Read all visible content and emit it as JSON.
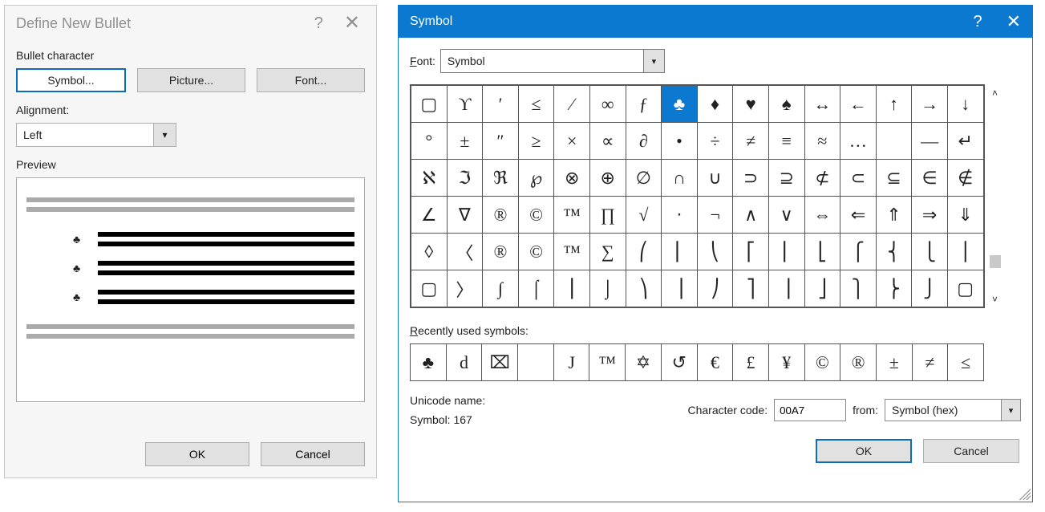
{
  "define": {
    "title": "Define New Bullet",
    "help": "?",
    "close": "✕",
    "bullet_char_label": "Bullet character",
    "symbol_btn": "Symbol...",
    "picture_btn": "Picture...",
    "font_btn": "Font...",
    "alignment_label": "Alignment:",
    "alignment_value": "Left",
    "preview_label": "Preview",
    "preview_bullet": "♣",
    "ok": "OK",
    "cancel": "Cancel"
  },
  "symbol": {
    "title": "Symbol",
    "help": "?",
    "close": "✕",
    "font_label": "Font:",
    "font_value": "Symbol",
    "grid": [
      [
        "▢",
        "ϒ",
        "′",
        "≤",
        "⁄",
        "∞",
        "ƒ",
        "♣",
        "♦",
        "♥",
        "♠",
        "↔",
        "←",
        "↑",
        "→",
        "↓"
      ],
      [
        "°",
        "±",
        "″",
        "≥",
        "×",
        "∝",
        "∂",
        "•",
        "÷",
        "≠",
        "≡",
        "≈",
        "…",
        "",
        "—",
        "↵"
      ],
      [
        "ℵ",
        "ℑ",
        "ℜ",
        "℘",
        "⊗",
        "⊕",
        "∅",
        "∩",
        "∪",
        "⊃",
        "⊇",
        "⊄",
        "⊂",
        "⊆",
        "∈",
        "∉"
      ],
      [
        "∠",
        "∇",
        "®",
        "©",
        "™",
        "∏",
        "√",
        "⋅",
        "¬",
        "∧",
        "∨",
        "⇔",
        "⇐",
        "⇑",
        "⇒",
        "⇓"
      ],
      [
        "◊",
        "〈",
        "®",
        "©",
        "™",
        "∑",
        "⎛",
        "⎜",
        "⎝",
        "⎡",
        "⎢",
        "⎣",
        "⎧",
        "⎨",
        "⎩",
        "⎪"
      ],
      [
        "▢",
        "〉",
        "∫",
        "⌠",
        "⎮",
        "⌡",
        "⎞",
        "⎟",
        "⎠",
        "⎤",
        "⎥",
        "⎦",
        "⎫",
        "⎬",
        "⎭",
        "▢"
      ]
    ],
    "selected_row": 0,
    "selected_col": 7,
    "recent_label": "Recently used symbols:",
    "recent": [
      "♣",
      "d",
      "⌧",
      "",
      "J",
      "™",
      "✡",
      "↺",
      "€",
      "£",
      "¥",
      "©",
      "®",
      "±",
      "≠",
      "≤"
    ],
    "unicode_name_label": "Unicode name:",
    "unicode_name_value": "Symbol: 167",
    "char_code_label": "Character code:",
    "char_code_value": "00A7",
    "from_label": "from:",
    "from_value": "Symbol (hex)",
    "ok": "OK",
    "cancel": "Cancel"
  },
  "chart_data": null
}
